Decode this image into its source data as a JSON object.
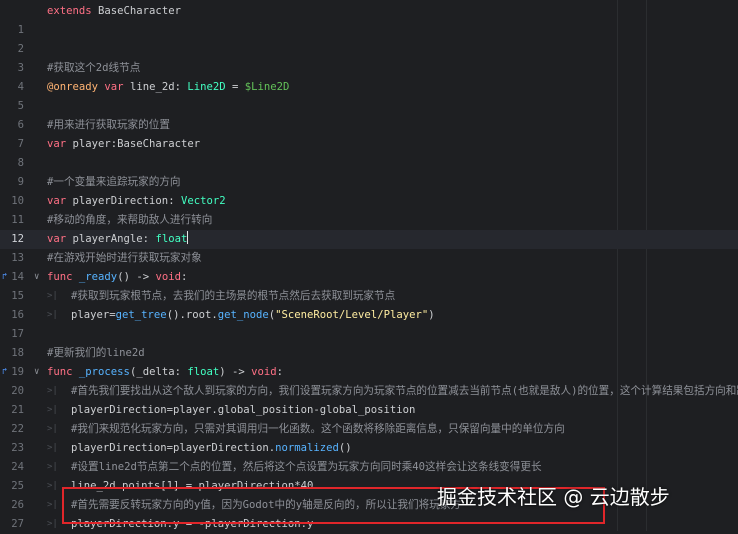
{
  "editor": {
    "colors": {
      "background": "#1e1f22",
      "keyword": "#ff7085",
      "type": "#42ffc2",
      "function": "#57b3ff",
      "string": "#ffeda1",
      "comment": "#8e9198",
      "node_path": "#63c259",
      "annotation": "#ffb373",
      "highlight_box": "#e0262a"
    },
    "lines": [
      {
        "num": "",
        "tokens": [
          {
            "c": "kw",
            "t": "extends"
          },
          {
            "c": "tx",
            "t": " BaseCharacter"
          }
        ]
      },
      {
        "num": "1",
        "tokens": []
      },
      {
        "num": "2",
        "tokens": []
      },
      {
        "num": "3",
        "tokens": [
          {
            "c": "cm",
            "t": "#获取这个2d线节点"
          }
        ]
      },
      {
        "num": "4",
        "tokens": [
          {
            "c": "an",
            "t": "@onready"
          },
          {
            "c": "tx",
            "t": " "
          },
          {
            "c": "kw",
            "t": "var"
          },
          {
            "c": "tx",
            "t": " line_2d: "
          },
          {
            "c": "tp",
            "t": "Line2D"
          },
          {
            "c": "tx",
            "t": " = "
          },
          {
            "c": "nd",
            "t": "$Line2D"
          }
        ]
      },
      {
        "num": "5",
        "tokens": []
      },
      {
        "num": "6",
        "tokens": [
          {
            "c": "cm",
            "t": "#用来进行获取玩家的位置"
          }
        ]
      },
      {
        "num": "7",
        "tokens": [
          {
            "c": "kw",
            "t": "var"
          },
          {
            "c": "tx",
            "t": " player:BaseCharacter"
          }
        ]
      },
      {
        "num": "8",
        "tokens": []
      },
      {
        "num": "9",
        "tokens": [
          {
            "c": "cm",
            "t": "#一个变量来追踪玩家的方向"
          }
        ]
      },
      {
        "num": "10",
        "tokens": [
          {
            "c": "kw",
            "t": "var"
          },
          {
            "c": "tx",
            "t": " playerDirection: "
          },
          {
            "c": "tp",
            "t": "Vector2"
          }
        ]
      },
      {
        "num": "11",
        "tokens": [
          {
            "c": "cm",
            "t": "#移动的角度，来帮助敌人进行转向"
          }
        ]
      },
      {
        "num": "12",
        "current": true,
        "tokens": [
          {
            "c": "kw",
            "t": "var"
          },
          {
            "c": "tx",
            "t": " playerAngle: "
          },
          {
            "c": "tp",
            "t": "float"
          }
        ]
      },
      {
        "num": "13",
        "tokens": [
          {
            "c": "cm",
            "t": "#在游戏开始时进行获取玩家对象"
          }
        ]
      },
      {
        "num": "14",
        "override": true,
        "fold": true,
        "tokens": [
          {
            "c": "kw",
            "t": "func"
          },
          {
            "c": "tx",
            "t": " "
          },
          {
            "c": "fn",
            "t": "_ready"
          },
          {
            "c": "tx",
            "t": "() -> "
          },
          {
            "c": "kw",
            "t": "void"
          },
          {
            "c": "tx",
            "t": ":"
          }
        ]
      },
      {
        "num": "15",
        "indent": 1,
        "tokens": [
          {
            "c": "cm",
            "t": "#获取到玩家根节点，去我们的主场景的根节点然后去获取到玩家节点"
          }
        ]
      },
      {
        "num": "16",
        "indent": 1,
        "tokens": [
          {
            "c": "tx",
            "t": "player="
          },
          {
            "c": "fn",
            "t": "get_tree"
          },
          {
            "c": "tx",
            "t": "().root."
          },
          {
            "c": "fn",
            "t": "get_node"
          },
          {
            "c": "tx",
            "t": "("
          },
          {
            "c": "st",
            "t": "\"SceneRoot/Level/Player\""
          },
          {
            "c": "tx",
            "t": ")"
          }
        ]
      },
      {
        "num": "17",
        "tokens": []
      },
      {
        "num": "18",
        "tokens": [
          {
            "c": "cm",
            "t": "#更新我们的line2d"
          }
        ]
      },
      {
        "num": "19",
        "override": true,
        "fold": true,
        "tokens": [
          {
            "c": "kw",
            "t": "func"
          },
          {
            "c": "tx",
            "t": " "
          },
          {
            "c": "fn",
            "t": "_process"
          },
          {
            "c": "tx",
            "t": "(_delta: "
          },
          {
            "c": "tp",
            "t": "float"
          },
          {
            "c": "tx",
            "t": ") -> "
          },
          {
            "c": "kw",
            "t": "void"
          },
          {
            "c": "tx",
            "t": ":"
          }
        ]
      },
      {
        "num": "20",
        "indent": 1,
        "tokens": [
          {
            "c": "cm",
            "t": "#首先我们要找出从这个敌人到玩家的方向，我们设置玩家方向为玩家节点的位置减去当前节点(也就是敌人)的位置，这个计算结果包括方向和距离"
          }
        ]
      },
      {
        "num": "21",
        "indent": 1,
        "tokens": [
          {
            "c": "tx",
            "t": "playerDirection=player.global_position-global_position"
          }
        ]
      },
      {
        "num": "22",
        "indent": 1,
        "tokens": [
          {
            "c": "cm",
            "t": "#我们来规范化玩家方向，只需对其调用归一化函数。这个函数将移除距离信息，只保留向量中的单位方向"
          }
        ]
      },
      {
        "num": "23",
        "indent": 1,
        "tokens": [
          {
            "c": "tx",
            "t": "playerDirection=playerDirection."
          },
          {
            "c": "fn",
            "t": "normalized"
          },
          {
            "c": "tx",
            "t": "()"
          }
        ]
      },
      {
        "num": "24",
        "indent": 1,
        "tokens": [
          {
            "c": "cm",
            "t": "#设置line2d节点第二个点的位置，然后将这个点设置为玩家方向同时乘40这样会让这条线变得更长"
          }
        ]
      },
      {
        "num": "25",
        "indent": 1,
        "tokens": [
          {
            "c": "tx",
            "t": "line_2d.points[1] = playerDirection*40"
          }
        ]
      },
      {
        "num": "26",
        "indent": 1,
        "tokens": [
          {
            "c": "cm",
            "t": "#首先需要反转玩家方向的y值，因为Godot中的y轴是反向的，所以让我们将玩家方"
          }
        ]
      },
      {
        "num": "27",
        "indent": 1,
        "tokens": [
          {
            "c": "tx",
            "t": "playerDirection.y = -playerDirection.y"
          }
        ]
      }
    ]
  },
  "watermark": {
    "text": "掘金技术社区 @ 云边散步"
  }
}
